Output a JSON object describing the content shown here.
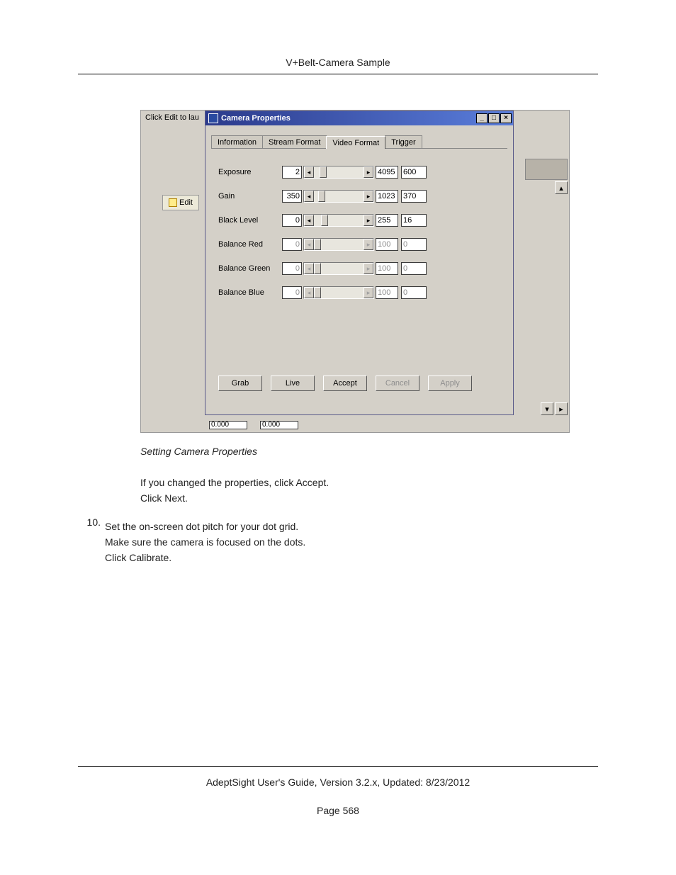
{
  "header": {
    "title": "V+Belt-Camera Sample"
  },
  "figure": {
    "hint": "Click Edit to lau",
    "edit_label": "Edit",
    "window_title": "Camera Properties",
    "titlebar_buttons": [
      "_",
      "□",
      "×"
    ],
    "tabs": [
      "Information",
      "Stream Format",
      "Video Format",
      "Trigger"
    ],
    "active_tab": 2,
    "rows": [
      {
        "label": "Exposure",
        "min": "2",
        "max": "4095",
        "val": "600",
        "thumb": 8,
        "disabled": false
      },
      {
        "label": "Gain",
        "min": "350",
        "max": "1023",
        "val": "370",
        "thumb": 6,
        "disabled": false
      },
      {
        "label": "Black Level",
        "min": "0",
        "max": "255",
        "val": "16",
        "thumb": 10,
        "disabled": false
      },
      {
        "label": "Balance Red",
        "min": "0",
        "max": "100",
        "val": "0",
        "thumb": 0,
        "disabled": true
      },
      {
        "label": "Balance Green",
        "min": "0",
        "max": "100",
        "val": "0",
        "thumb": 0,
        "disabled": true
      },
      {
        "label": "Balance Blue",
        "min": "0",
        "max": "100",
        "val": "0",
        "thumb": 0,
        "disabled": true
      }
    ],
    "buttons": [
      {
        "label": "Grab",
        "disabled": false
      },
      {
        "label": "Live",
        "disabled": false
      },
      {
        "label": "Accept",
        "disabled": false
      },
      {
        "label": "Cancel",
        "disabled": true
      },
      {
        "label": "Apply",
        "disabled": true
      }
    ],
    "below": [
      "0.000",
      "0.000"
    ]
  },
  "caption": "Setting Camera Properties",
  "body": {
    "p1": "If you changed the properties, click Accept.",
    "p2": "Click Next.",
    "step_num": "10.",
    "s1": "Set the on-screen dot pitch for your dot grid.",
    "s2": "Make sure the camera is focused on the dots.",
    "s3": "Click Calibrate."
  },
  "footer": {
    "line": "AdeptSight User's Guide,  Version 3.2.x, Updated: 8/23/2012",
    "page": "Page 568"
  }
}
